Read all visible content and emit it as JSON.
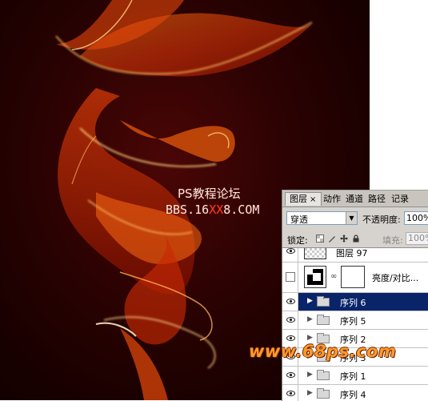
{
  "canvas": {
    "watermark_line1": "PS教程论坛",
    "watermark_line2_pre": "BBS.16",
    "watermark_line2_hl": "XX",
    "watermark_line2_post": "8.COM",
    "site_watermark": "www.68ps.com"
  },
  "panel": {
    "tabs": [
      {
        "label": "图层",
        "active": true
      },
      {
        "label": "动作"
      },
      {
        "label": "通道"
      },
      {
        "label": "路径"
      },
      {
        "label": "记录"
      }
    ],
    "close_glyph": "×",
    "blend_mode": "穿透",
    "opacity_label": "不透明度:",
    "opacity_value": "100%",
    "lock_label": "锁定:",
    "fill_label": "填充:",
    "fill_value": "100%",
    "layers": [
      {
        "name": "图层 97",
        "type": "layer"
      },
      {
        "name": "亮度/对比...",
        "type": "adjustment"
      },
      {
        "name": "序列 6",
        "type": "group",
        "selected": true
      },
      {
        "name": "序列 5",
        "type": "group"
      },
      {
        "name": "序列 2",
        "type": "group"
      },
      {
        "name": "序列 3",
        "type": "group"
      },
      {
        "name": "序列 1",
        "type": "group"
      },
      {
        "name": "序列 4",
        "type": "group"
      }
    ]
  },
  "colors": {
    "selection": "#0a246a",
    "panel_bg": "#d6d3ce",
    "site_watermark": "#ff9a2a"
  }
}
